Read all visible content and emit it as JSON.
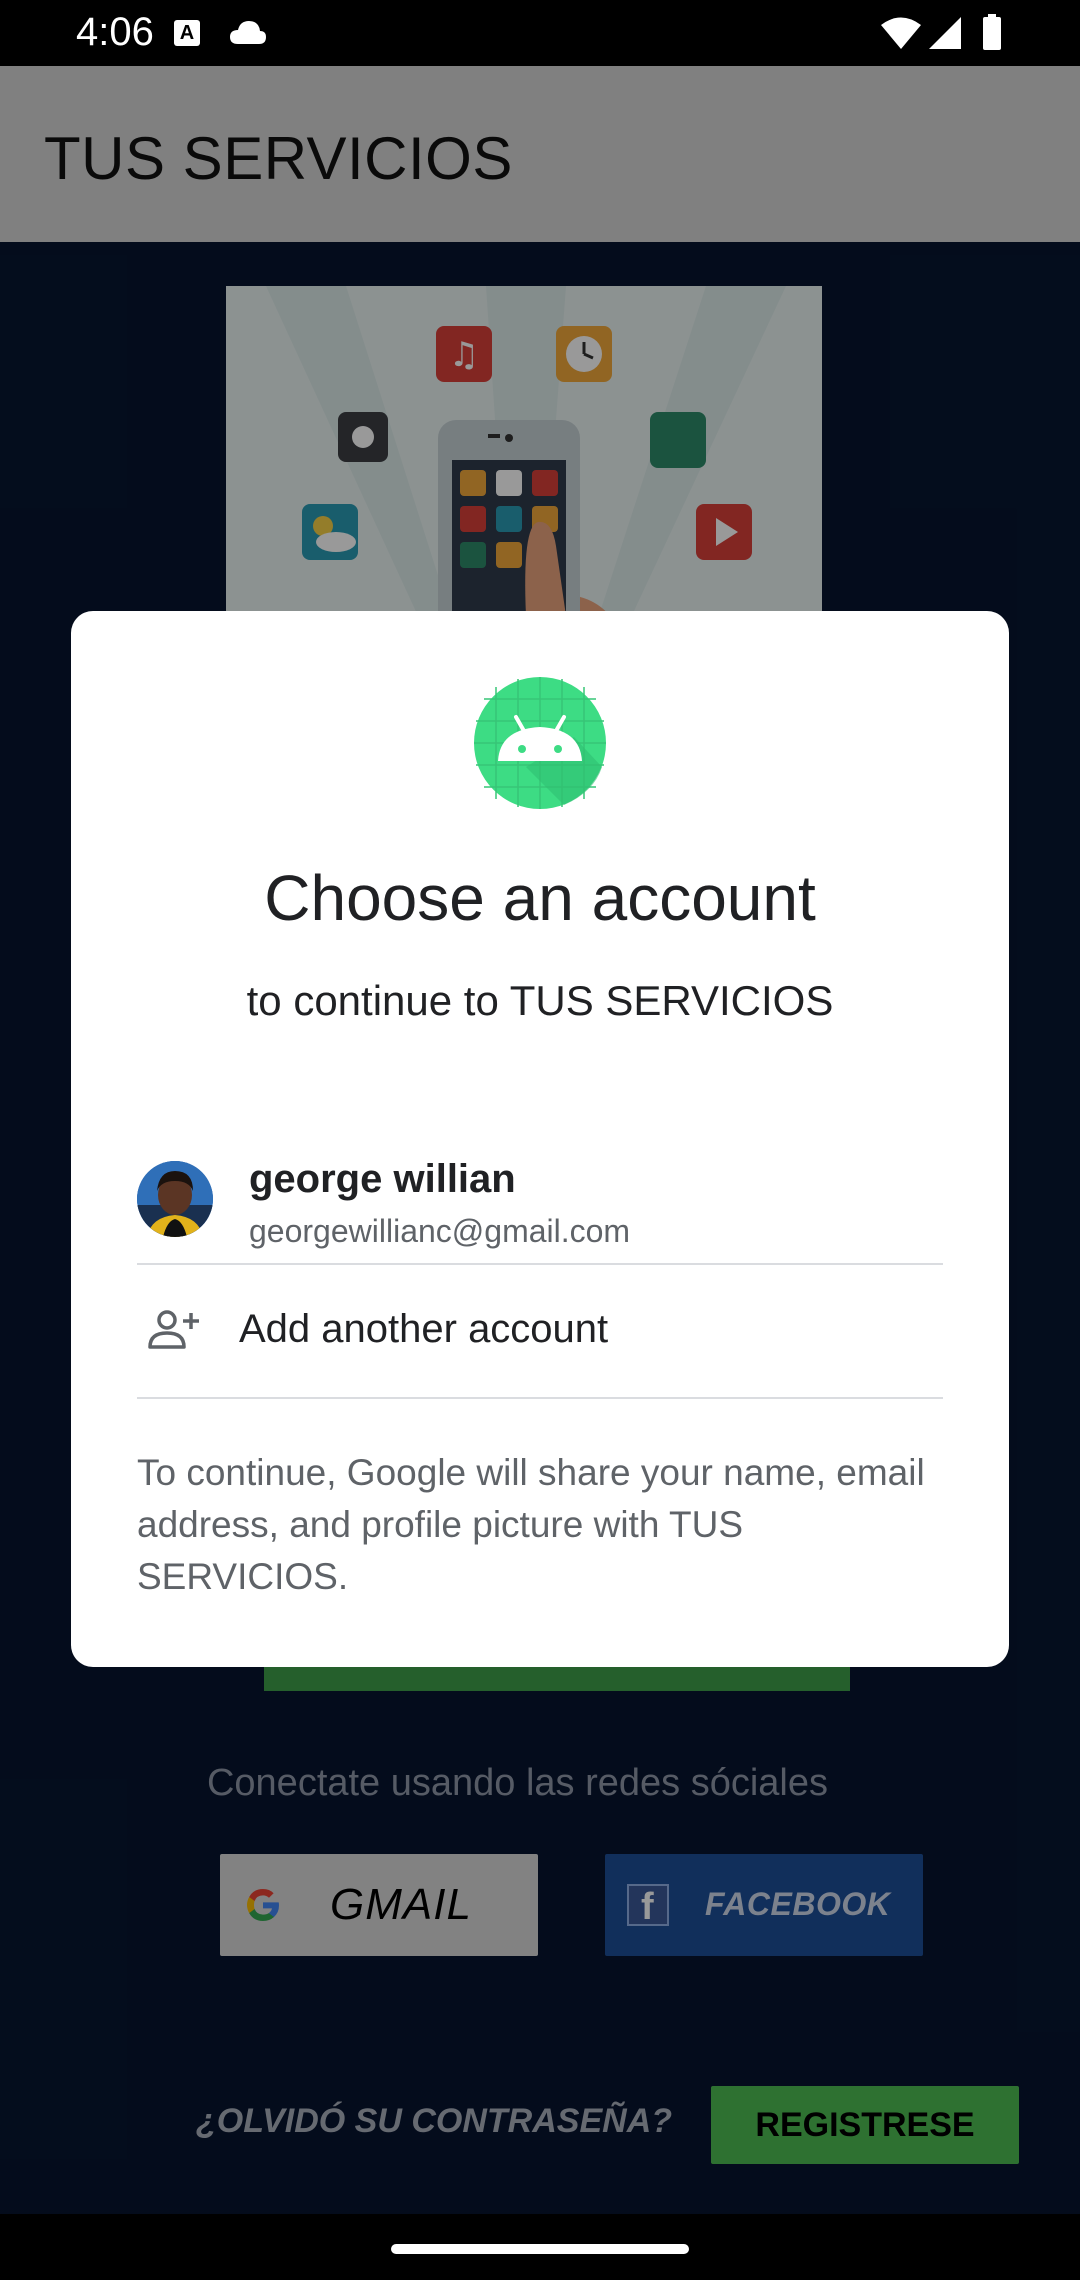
{
  "status_bar": {
    "time": "4:06",
    "a_badge": "A",
    "icons": [
      "a-notification-icon",
      "cloud-icon",
      "wifi-icon",
      "signal-icon",
      "battery-icon"
    ]
  },
  "app": {
    "title": "TUS SERVICIOS",
    "connect_text": "Conectate usando las redes sóciales",
    "gmail_label": "GMAIL",
    "facebook_label": "FACEBOOK",
    "forgot_label": "¿OLVIDÓ SU CONTRASEÑA?",
    "register_label": "REGISTRESE"
  },
  "dialog": {
    "title": "Choose an account",
    "subtitle": "to continue to TUS SERVICIOS",
    "account": {
      "name": "george willian",
      "email": "georgewillianc@gmail.com"
    },
    "add_account_label": "Add another account",
    "disclaimer": "To continue, Google will share your name, email address, and profile picture with TUS SERVICIOS."
  },
  "colors": {
    "app_background": "#071530",
    "toolbar": "#d6d6d6",
    "android_icon": "#3ddc84",
    "register_button": "#4dbd53",
    "facebook_button": "#1d4f98"
  }
}
